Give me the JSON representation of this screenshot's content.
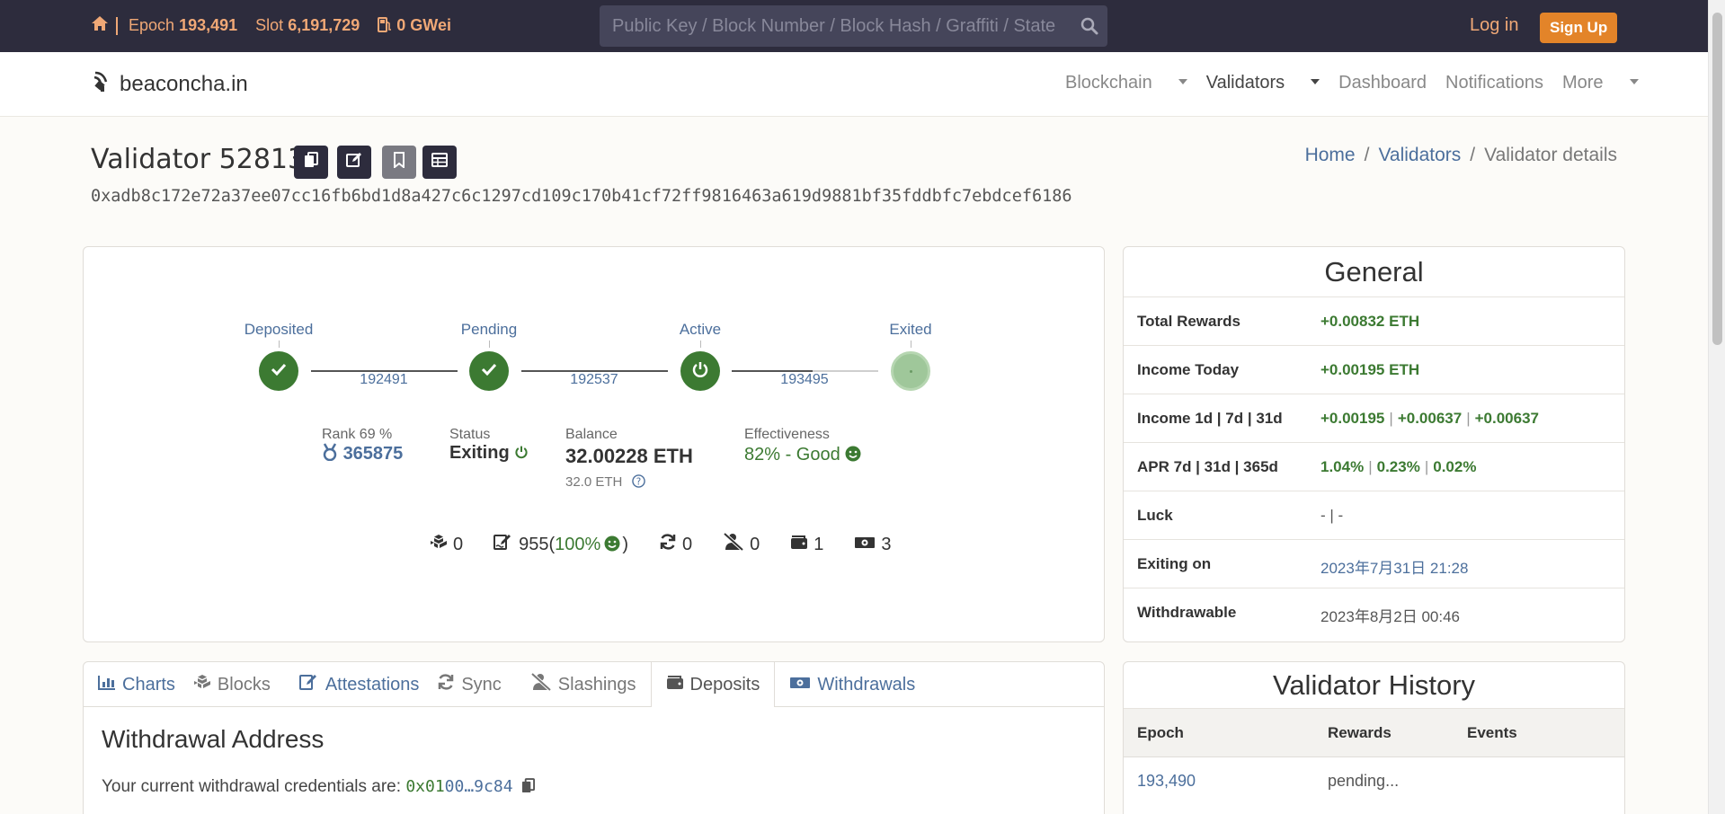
{
  "topbar": {
    "epoch_label": "Epoch",
    "epoch_value": "193,491",
    "slot_label": "Slot",
    "slot_value": "6,191,729",
    "gas_value": "0 GWei",
    "search_placeholder": "Public Key / Block Number / Block Hash / Graffiti / State",
    "login_label": "Log in",
    "signup_label": "Sign Up"
  },
  "nav": {
    "brand": "beaconcha.in",
    "items": [
      "Blockchain",
      "Validators",
      "Dashboard",
      "Notifications",
      "More"
    ]
  },
  "header": {
    "title": "Validator 528134",
    "pubkey": "0xadb8c172e72a37ee07cc16fb6bd1d8a427c6c1297cd109c170b41cf72ff9816463a619d9881bf35fddbfc7ebdcef6186",
    "breadcrumb": [
      "Home",
      "Validators",
      "Validator details"
    ]
  },
  "timeline": {
    "stages": [
      "Deposited",
      "Pending",
      "Active",
      "Exited"
    ],
    "epochs": [
      "192491",
      "192537",
      "193495"
    ]
  },
  "stats": {
    "rank_label": "Rank 69 %",
    "rank_value": "365875",
    "status_label": "Status",
    "status_value": "Exiting",
    "balance_label": "Balance",
    "balance_value": "32.00228 ETH",
    "balance_sub": "32.0 ETH",
    "effectiveness_label": "Effectiveness",
    "effectiveness_value": "82% - Good"
  },
  "counts": {
    "blocks": "0",
    "attestations": "955",
    "attestations_pct": "100%",
    "sync": "0",
    "slashings": "0",
    "deposits": "1",
    "withdrawals": "3"
  },
  "general": {
    "title": "General",
    "total_rewards_label": "Total Rewards",
    "total_rewards_value": "+0.00832 ETH",
    "income_today_label": "Income Today",
    "income_today_value": "+0.00195 ETH",
    "income_label": "Income 1d | 7d | 31d",
    "income_1d": "+0.00195",
    "income_7d": "+0.00637",
    "income_31d": "+0.00637",
    "apr_label": "APR 7d | 31d | 365d",
    "apr_7d": "1.04%",
    "apr_31d": "0.23%",
    "apr_365d": "0.02%",
    "luck_label": "Luck",
    "luck_value": "- | -",
    "exiting_label": "Exiting on",
    "exiting_value": "2023年7月31日 21:28",
    "withdrawable_label": "Withdrawable",
    "withdrawable_value": "2023年8月2日 00:46"
  },
  "tabs": [
    "Charts",
    "Blocks",
    "Attestations",
    "Sync",
    "Slashings",
    "Deposits",
    "Withdrawals"
  ],
  "withdrawal": {
    "title": "Withdrawal Address",
    "text": "Your current withdrawal credentials are:",
    "addr_prefix": "0x01",
    "addr_rest": "00…9c84"
  },
  "history": {
    "title": "Validator History",
    "columns": [
      "Epoch",
      "Rewards",
      "Events"
    ],
    "rows": [
      {
        "epoch": "193,490",
        "rewards": "pending..."
      }
    ]
  },
  "colors": {
    "topbar_bg": "#2d2c3d",
    "accent_orange": "#e38429",
    "positive_green": "#3c7a32",
    "link_blue": "#4c6f9c"
  }
}
